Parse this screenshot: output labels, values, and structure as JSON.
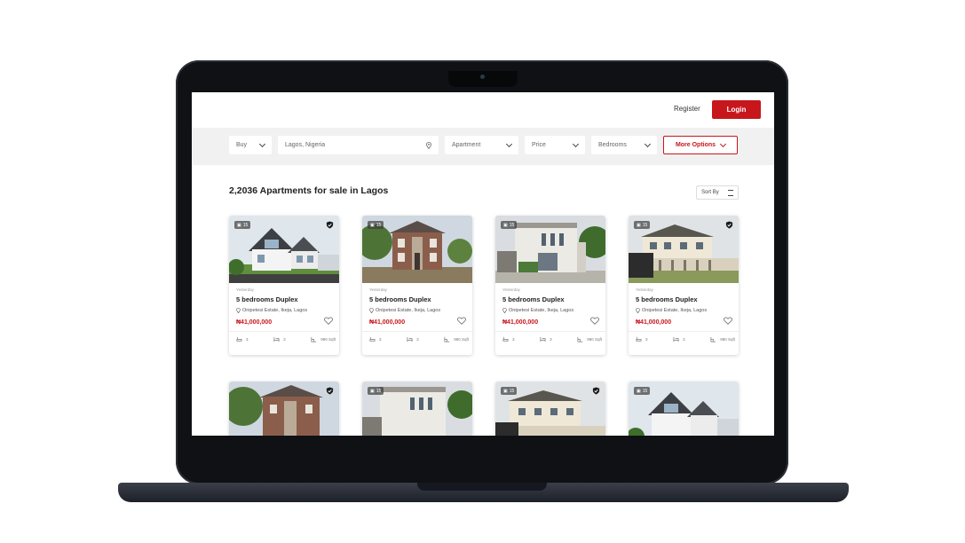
{
  "header": {
    "register_label": "Register",
    "login_label": "Login"
  },
  "filters": {
    "type": "Buy",
    "location": "Lagos, Nigeria",
    "property_type": "Apartment",
    "price": "Price",
    "bedrooms": "Bedrooms",
    "more_options": "More Options"
  },
  "results": {
    "heading": "2,2036 Apartments for sale in Lagos",
    "sort_label": "Sort By"
  },
  "listings": [
    {
      "photo_count": "15",
      "date": "Yesterday",
      "title": "5 bedrooms Duplex",
      "location": "Onipetesi Estate, Ikeja, Lagos",
      "price": "₦41,000,000",
      "baths": "3",
      "beds": "3",
      "area": "980 Sqft",
      "verified": true
    },
    {
      "photo_count": "15",
      "date": "Yesterday",
      "title": "5 bedrooms Duplex",
      "location": "Onipetesi Estate, Ikeja, Lagos",
      "price": "₦41,000,000",
      "baths": "3",
      "beds": "3",
      "area": "980 Sqft",
      "verified": false
    },
    {
      "photo_count": "15",
      "date": "Yesterday",
      "title": "5 bedrooms Duplex",
      "location": "Onipetesi Estate, Ikeja, Lagos",
      "price": "₦41,000,000",
      "baths": "3",
      "beds": "3",
      "area": "980 Sqft",
      "verified": false
    },
    {
      "photo_count": "15",
      "date": "Yesterday",
      "title": "5 bedrooms Duplex",
      "location": "Onipetesi Estate, Ikeja, Lagos",
      "price": "₦41,000,000",
      "baths": "3",
      "beds": "3",
      "area": "980 Sqft",
      "verified": true
    }
  ],
  "listings_row2": [
    {
      "photo_count": "",
      "verified": true
    },
    {
      "photo_count": "15",
      "verified": false
    },
    {
      "photo_count": "15",
      "verified": true
    },
    {
      "photo_count": "15",
      "verified": false
    }
  ],
  "colors": {
    "accent": "#c8161d",
    "frame": "#0f1114",
    "filter_bg": "#f1f1f1"
  }
}
